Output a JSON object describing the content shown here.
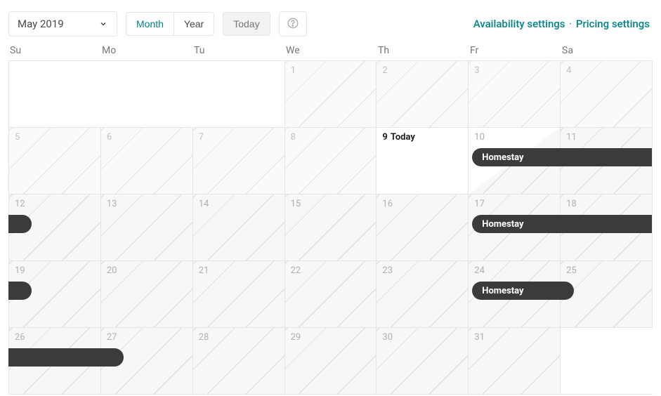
{
  "toolbar": {
    "month_label": "May 2019",
    "view_month": "Month",
    "view_year": "Year",
    "today_label": "Today",
    "links": {
      "availability": "Availability settings",
      "pricing": "Pricing settings"
    }
  },
  "dow": [
    "Su",
    "Mo",
    "Tu",
    "We",
    "Th",
    "Fr",
    "Sa"
  ],
  "today_text": "Today",
  "days": [
    {
      "n": "",
      "cls": "empty"
    },
    {
      "n": "",
      "cls": "empty"
    },
    {
      "n": "",
      "cls": "empty edge-right"
    },
    {
      "n": "1",
      "cls": "past"
    },
    {
      "n": "2",
      "cls": "past"
    },
    {
      "n": "3",
      "cls": "past"
    },
    {
      "n": "4",
      "cls": "past"
    },
    {
      "n": "5",
      "cls": "past"
    },
    {
      "n": "6",
      "cls": "past"
    },
    {
      "n": "7",
      "cls": "past"
    },
    {
      "n": "8",
      "cls": "past"
    },
    {
      "n": "9",
      "cls": "today",
      "today": true
    },
    {
      "n": "10",
      "cls": "blocked-first"
    },
    {
      "n": "11",
      "cls": "blocked"
    },
    {
      "n": "12",
      "cls": "blocked"
    },
    {
      "n": "13",
      "cls": "blocked"
    },
    {
      "n": "14",
      "cls": "blocked"
    },
    {
      "n": "15",
      "cls": "blocked"
    },
    {
      "n": "16",
      "cls": "blocked"
    },
    {
      "n": "17",
      "cls": "blocked"
    },
    {
      "n": "18",
      "cls": "blocked"
    },
    {
      "n": "19",
      "cls": "blocked"
    },
    {
      "n": "20",
      "cls": "blocked"
    },
    {
      "n": "21",
      "cls": "blocked"
    },
    {
      "n": "22",
      "cls": "blocked"
    },
    {
      "n": "23",
      "cls": "blocked"
    },
    {
      "n": "24",
      "cls": "blocked"
    },
    {
      "n": "25",
      "cls": "blocked"
    },
    {
      "n": "26",
      "cls": "blocked"
    },
    {
      "n": "27",
      "cls": "blocked"
    },
    {
      "n": "28",
      "cls": "blocked"
    },
    {
      "n": "29",
      "cls": "blocked"
    },
    {
      "n": "30",
      "cls": "blocked"
    },
    {
      "n": "31",
      "cls": "blocked"
    },
    {
      "n": "",
      "cls": "empty"
    }
  ],
  "events": [
    {
      "label": "Homestay",
      "row": 1,
      "col_start": 5,
      "col_end": 7,
      "round_l": true,
      "round_r": false,
      "show_label": true
    },
    {
      "label": "",
      "row": 2,
      "col_start": 0,
      "col_end": 0.25,
      "round_l": false,
      "round_r": true,
      "show_label": false
    },
    {
      "label": "Homestay",
      "row": 2,
      "col_start": 5,
      "col_end": 7,
      "round_l": true,
      "round_r": false,
      "show_label": true
    },
    {
      "label": "",
      "row": 3,
      "col_start": 0,
      "col_end": 0.25,
      "round_l": false,
      "round_r": true,
      "show_label": false
    },
    {
      "label": "Homestay",
      "row": 3,
      "col_start": 5,
      "col_end": 6.15,
      "round_l": true,
      "round_r": true,
      "show_label": true
    },
    {
      "label": "",
      "row": 4,
      "col_start": 0,
      "col_end": 1.25,
      "round_l": false,
      "round_r": true,
      "show_label": false
    }
  ]
}
